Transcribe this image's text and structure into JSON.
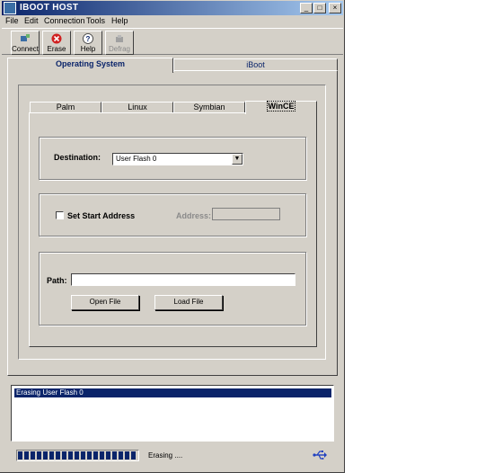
{
  "window": {
    "title": "IBOOT HOST",
    "controls": {
      "minimize": "_",
      "maximize": "□",
      "close": "×"
    }
  },
  "menu": [
    "File",
    "Edit",
    "Connection",
    "Tools",
    "Help"
  ],
  "toolbar": [
    {
      "label": "Connect",
      "icon": "connect-icon",
      "enabled": true
    },
    {
      "label": "Erase",
      "icon": "erase-icon",
      "enabled": true
    },
    {
      "label": "Help",
      "icon": "help-icon",
      "enabled": true
    },
    {
      "label": "Defrag",
      "icon": "defrag-icon",
      "enabled": false
    }
  ],
  "main_tabs": {
    "operating_system": "Operating System",
    "iboot": "iBoot",
    "active": "operating_system"
  },
  "os_tabs": {
    "palm": "Palm",
    "linux": "Linux",
    "symbian": "Symbian",
    "wince": "WinCE",
    "active": "wince"
  },
  "destination": {
    "label": "Destination:",
    "value": "User Flash 0"
  },
  "start_address": {
    "checkbox_label": "Set Start Address",
    "checked": false,
    "address_label": "Address:",
    "address_value": ""
  },
  "path": {
    "label": "Path:",
    "value": ""
  },
  "buttons": {
    "open_file": "Open File",
    "load_file": "Load File"
  },
  "log": {
    "entries": [
      "Erasing User Flash 0"
    ]
  },
  "status": {
    "text": "Erasing ....",
    "progress_fraction": 1.0
  },
  "colors": {
    "face": "#d4d0c8",
    "title_start": "#0a246a",
    "title_end": "#a6caf0",
    "selection": "#0a246a"
  }
}
